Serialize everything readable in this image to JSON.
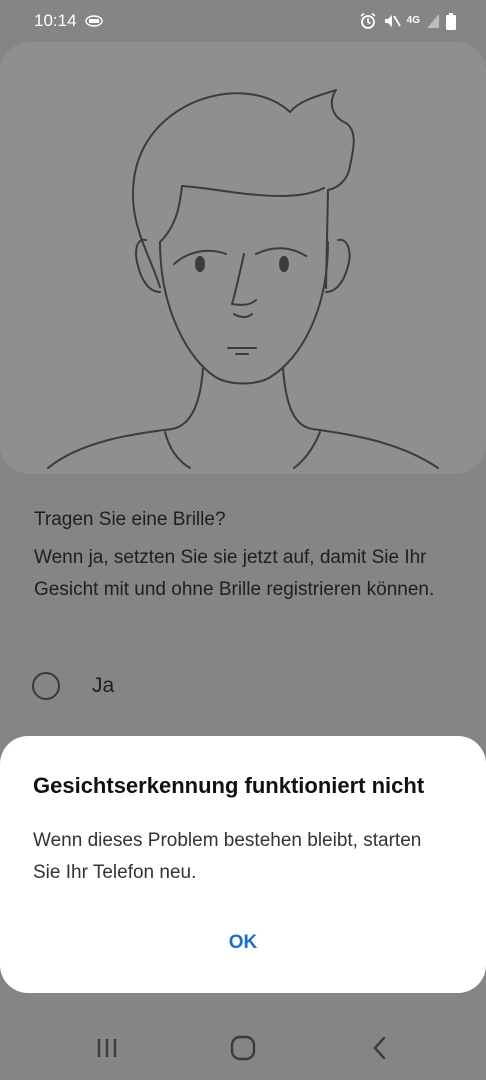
{
  "status_bar": {
    "time": "10:14",
    "network": "4G",
    "icons": [
      "app-notification-icon",
      "alarm-icon",
      "mute-icon",
      "signal-icon",
      "battery-icon"
    ]
  },
  "illustration": {
    "icon": "face-outline-illustration"
  },
  "question": {
    "title": "Tragen Sie eine Brille?",
    "description": "Wenn ja, setzten Sie sie jetzt auf, damit Sie Ihr Gesicht mit und ohne Brille registrieren können.",
    "option_yes": "Ja"
  },
  "dialog": {
    "title": "Gesichtserkennung funktioniert nicht",
    "message": "Wenn dieses Problem bestehen bleibt, starten Sie Ihr Telefon neu.",
    "ok_label": "OK"
  },
  "navigation": {
    "icons": [
      "recent-apps-icon",
      "home-icon",
      "back-icon"
    ]
  },
  "colors": {
    "accent": "#1a6fc9",
    "scrim": "#858585",
    "dialog_bg": "#ffffff"
  }
}
